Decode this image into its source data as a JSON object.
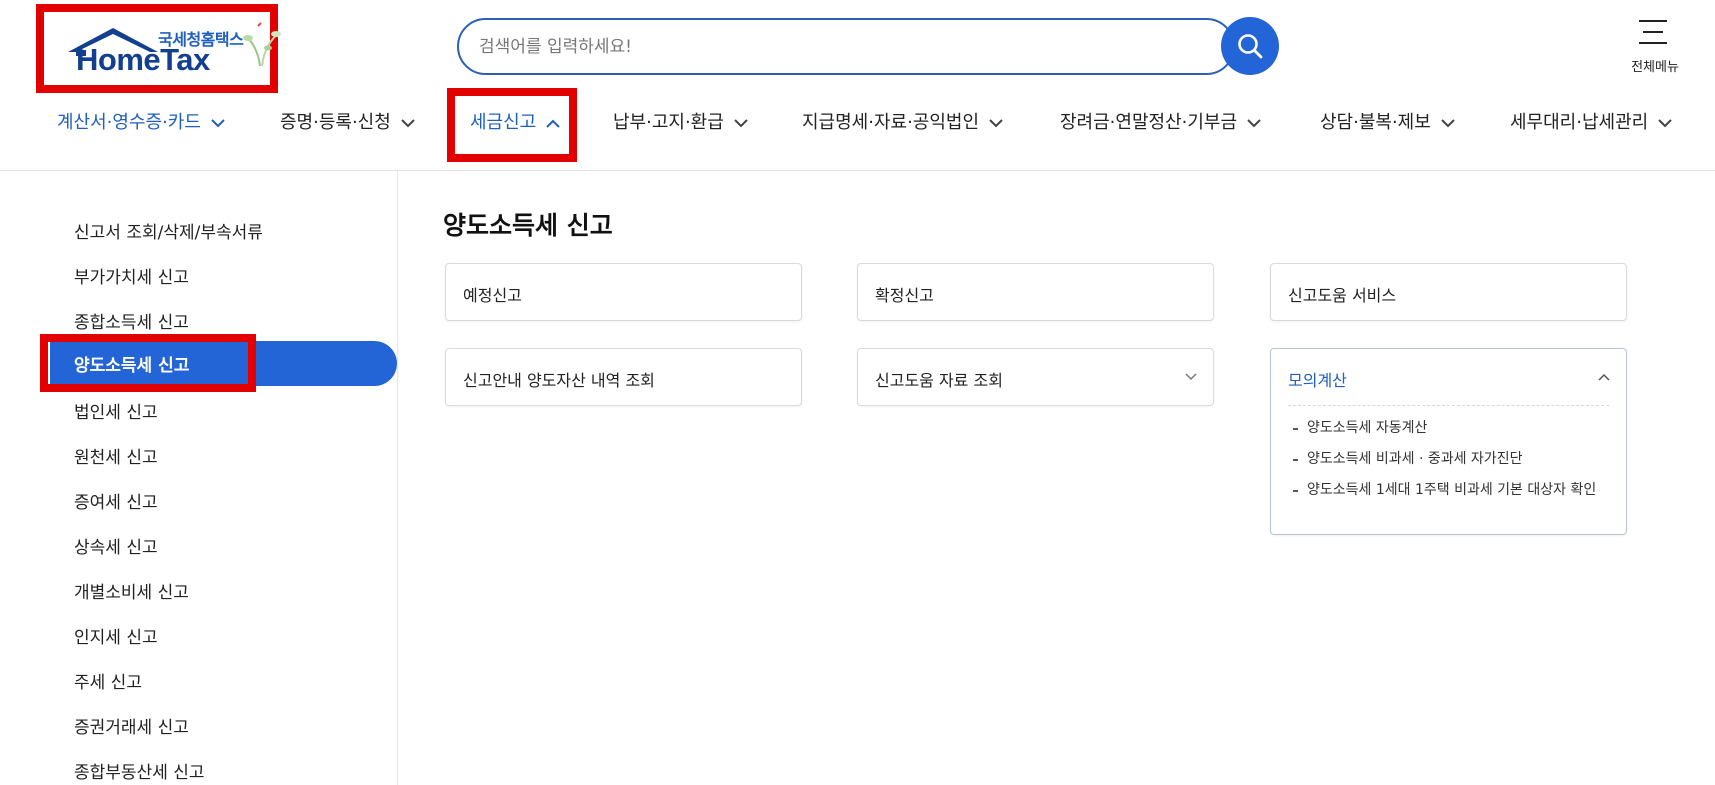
{
  "header": {
    "logo_kr": "국세청홈택스",
    "logo_en": "HomeTax",
    "search_placeholder": "검색어를 입력하세요!",
    "all_menu_label": "전체메뉴"
  },
  "gnb": [
    {
      "label": "계산서·영수증·카드",
      "active": true
    },
    {
      "label": "증명·등록·신청",
      "active": false
    },
    {
      "label": "세금신고",
      "active": true,
      "expanded": true
    },
    {
      "label": "납부·고지·환급",
      "active": false
    },
    {
      "label": "지급명세·자료·공익법인",
      "active": false
    },
    {
      "label": "장려금·연말정산·기부금",
      "active": false
    },
    {
      "label": "상담·불복·제보",
      "active": false
    },
    {
      "label": "세무대리·납세관리",
      "active": false
    }
  ],
  "sidebar": {
    "items": [
      "신고서 조회/삭제/부속서류",
      "부가가치세 신고",
      "종합소득세 신고",
      "양도소득세 신고",
      "법인세 신고",
      "원천세 신고",
      "증여세 신고",
      "상속세 신고",
      "개별소비세 신고",
      "인지세 신고",
      "주세 신고",
      "증권거래세 신고",
      "종합부동산세 신고"
    ],
    "active_index": 3
  },
  "main": {
    "title": "양도소득세 신고",
    "cards": {
      "c1": "예정신고",
      "c2": "확정신고",
      "c3": "신고도움 서비스",
      "c4": "신고안내 양도자산 내역 조회",
      "c5": "신고도움 자료 조회",
      "c6": "모의계산"
    },
    "mock_calc_items": [
      "양도소득세 자동계산",
      "양도소득세 비과세 · 중과세 자가진단",
      "양도소득세 1세대 1주택 비과세 기본 대상자 확인"
    ]
  },
  "colors": {
    "accent": "#2365d7",
    "highlight_box": "#e20000",
    "active_text": "#1f5fbf"
  }
}
